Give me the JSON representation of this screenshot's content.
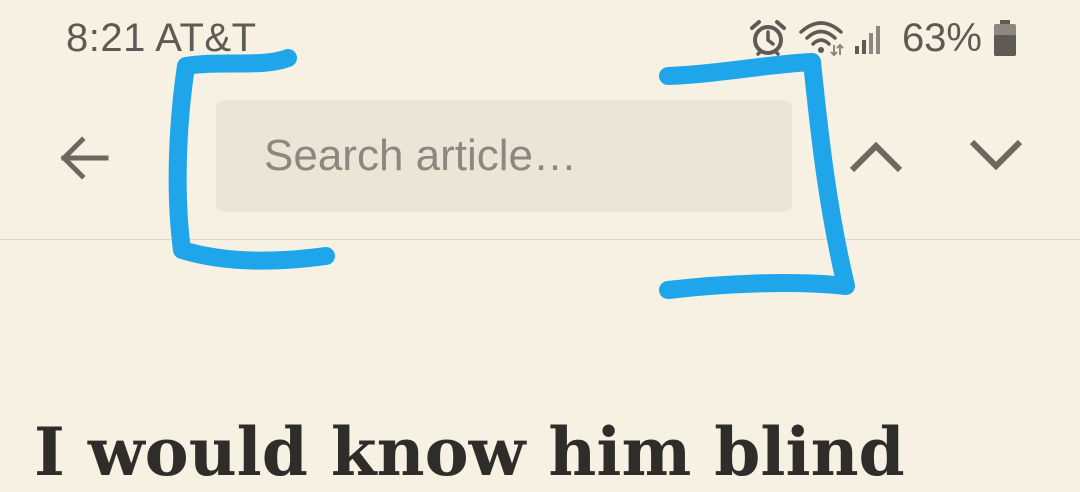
{
  "status_bar": {
    "time_carrier": "8:21 AT&T",
    "battery_percent": "63%",
    "icons": [
      "alarm-icon",
      "wifi-icon",
      "cellular-signal-icon",
      "battery-icon"
    ]
  },
  "toolbar": {
    "back_icon": "arrow-left-icon",
    "search_placeholder": "Search article…",
    "search_value": "",
    "prev_icon": "chevron-up-icon",
    "next_icon": "chevron-down-icon"
  },
  "article": {
    "title": "I would know him blind"
  },
  "colors": {
    "background": "#f6f1e3",
    "search_field": "#ebe5d7",
    "icon": "#6b6860",
    "annotation_marker": "#1ea5ea"
  }
}
